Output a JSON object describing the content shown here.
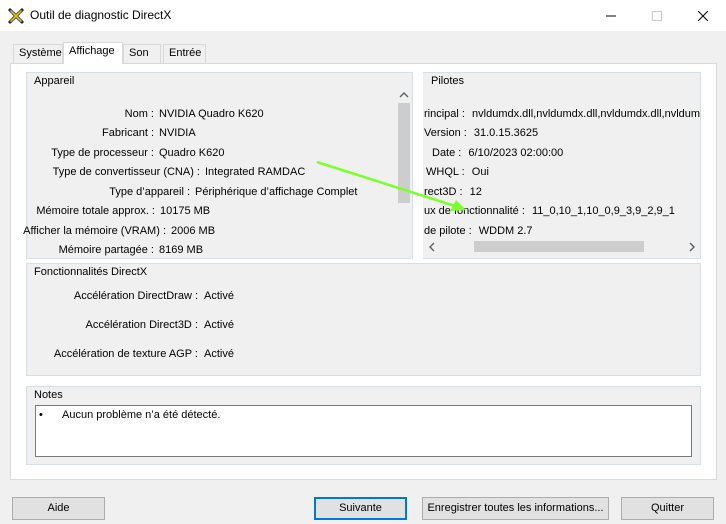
{
  "window": {
    "title": "Outil de diagnostic DirectX",
    "icon": "directx-x-icon",
    "controls": [
      "minimize-icon",
      "maximize-icon",
      "close-icon"
    ]
  },
  "tabs": [
    {
      "label": "Système"
    },
    {
      "label": "Affichage",
      "active": true
    },
    {
      "label": "Son"
    },
    {
      "label": "Entrée"
    }
  ],
  "device": {
    "title": "Appareil",
    "rows": [
      {
        "label": "Nom :",
        "value": "NVIDIA Quadro K620"
      },
      {
        "label": "Fabricant :",
        "value": "NVIDIA"
      },
      {
        "label": "Type de processeur :",
        "value": "Quadro K620"
      },
      {
        "label": "Type de convertisseur (CNA) :",
        "value": "Integrated RAMDAC"
      },
      {
        "label": "Type d’appareil :",
        "value": "Périphérique d’affichage Complet"
      },
      {
        "label": "Mémoire totale approx. :",
        "value": "10175 MB"
      },
      {
        "label": "Afficher la mémoire (VRAM) :",
        "value": "2006 MB"
      },
      {
        "label": "Mémoire partagée :",
        "value": "8169 MB"
      }
    ]
  },
  "drivers": {
    "title": "Pilotes",
    "rows": [
      {
        "label": "rincipal :",
        "value": "nvldumdx.dll,nvldumdx.dll,nvldumdx.dll,nvldumd"
      },
      {
        "label": "Version :",
        "value": "31.0.15.3625"
      },
      {
        "label": "Date :",
        "value": "6/10/2023 02:00:00"
      },
      {
        "label": "WHQL :",
        "value": "Oui"
      },
      {
        "label": "rect3D :",
        "value": "12"
      },
      {
        "label": "ux de fonctionnalité :",
        "value": "11_0,10_1,10_0,9_3,9_2,9_1"
      },
      {
        "label": "de pilote :",
        "value": "WDDM 2.7"
      }
    ]
  },
  "features": {
    "title": "Fonctionnalités DirectX",
    "rows": [
      {
        "label": "Accélération DirectDraw :",
        "value": "Activé"
      },
      {
        "label": "Accélération Direct3D :",
        "value": "Activé"
      },
      {
        "label": "Accélération de texture AGP :",
        "value": "Activé"
      }
    ]
  },
  "notes": {
    "title": "Notes",
    "items": [
      "Aucun problème n’a été détecté."
    ]
  },
  "buttons": {
    "help": "Aide",
    "next": "Suivante",
    "save_all": "Enregistrer toutes les informations...",
    "quit": "Quitter"
  },
  "annotation": {
    "color": "#7cff2a"
  }
}
